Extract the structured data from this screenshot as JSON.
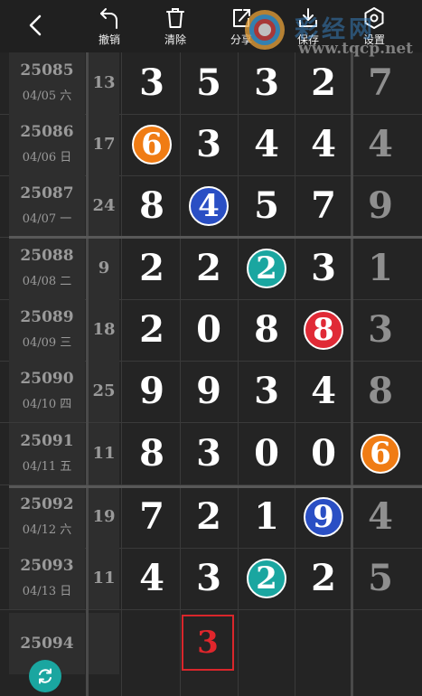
{
  "toolbar": {
    "undo": "撤销",
    "clear": "清除",
    "share": "分享",
    "save": "保存",
    "settings": "设置"
  },
  "watermark": {
    "cn": "彩经网",
    "url": "www.tqcp.net"
  },
  "colors": {
    "orange": "#f07c14",
    "blue": "#2a4fc4",
    "teal": "#1aa6a0",
    "red": "#e02a36",
    "current_border": "#d9262b"
  },
  "rows": [
    {
      "no": "25085",
      "date": "04/05 六",
      "sum": "13",
      "digits": [
        "3",
        "5",
        "3",
        "2",
        "7"
      ]
    },
    {
      "no": "25086",
      "date": "04/06 日",
      "sum": "17",
      "digits": [
        "6",
        "3",
        "4",
        "4",
        "4"
      ]
    },
    {
      "no": "25087",
      "date": "04/07 一",
      "sum": "24",
      "digits": [
        "8",
        "4",
        "5",
        "7",
        "9"
      ]
    },
    {
      "no": "25088",
      "date": "04/08 二",
      "sum": "9",
      "digits": [
        "2",
        "2",
        "2",
        "3",
        "1"
      ]
    },
    {
      "no": "25089",
      "date": "04/09 三",
      "sum": "18",
      "digits": [
        "2",
        "0",
        "8",
        "8",
        "3"
      ]
    },
    {
      "no": "25090",
      "date": "04/10 四",
      "sum": "25",
      "digits": [
        "9",
        "9",
        "3",
        "4",
        "8"
      ]
    },
    {
      "no": "25091",
      "date": "04/11 五",
      "sum": "11",
      "digits": [
        "8",
        "3",
        "0",
        "0",
        "6"
      ]
    },
    {
      "no": "25092",
      "date": "04/12 六",
      "sum": "19",
      "digits": [
        "7",
        "2",
        "1",
        "9",
        "4"
      ]
    },
    {
      "no": "25093",
      "date": "04/13 日",
      "sum": "11",
      "digits": [
        "4",
        "3",
        "2",
        "2",
        "5"
      ]
    }
  ],
  "current": {
    "no": "25094",
    "pick": "3"
  }
}
